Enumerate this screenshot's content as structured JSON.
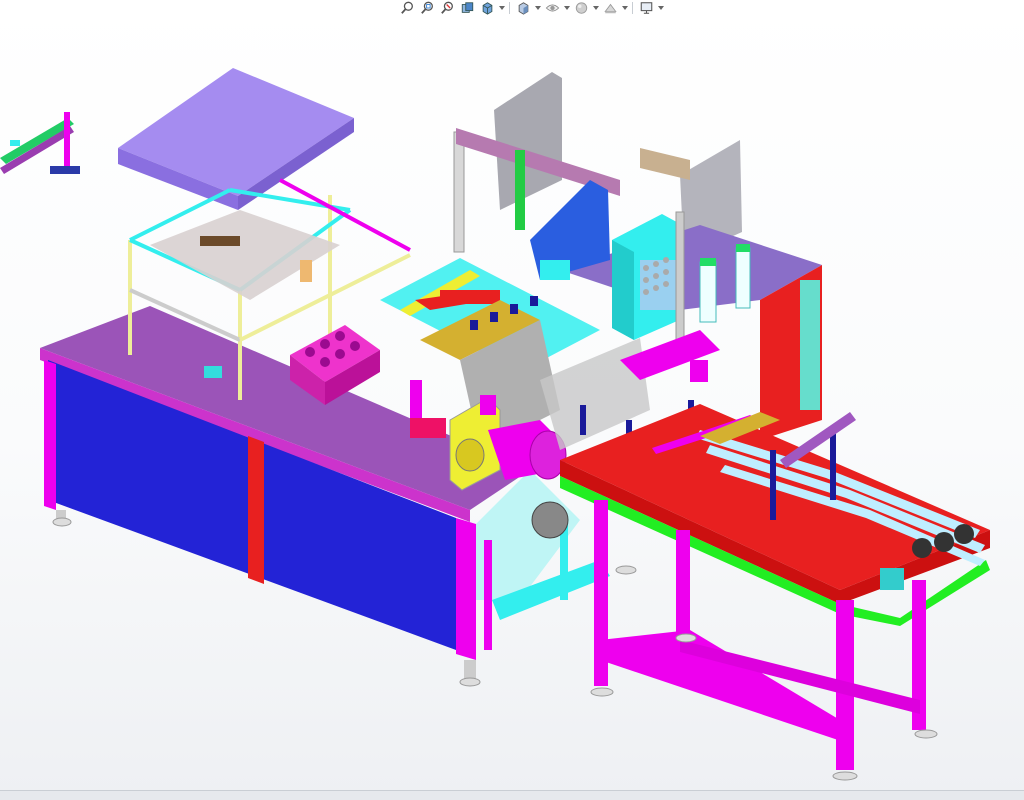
{
  "toolbar": {
    "items": [
      {
        "icon": "zoom-to-fit-icon"
      },
      {
        "icon": "zoom-to-area-icon"
      },
      {
        "icon": "previous-view-icon"
      },
      {
        "icon": "section-view-icon"
      },
      {
        "icon": "view-orientation-icon",
        "dropdown": true
      },
      {
        "icon": "display-style-icon",
        "dropdown": true
      },
      {
        "icon": "hide-show-items-icon",
        "dropdown": true
      },
      {
        "icon": "edit-appearance-icon",
        "dropdown": true
      },
      {
        "icon": "apply-scene-icon",
        "dropdown": true
      },
      {
        "icon": "view-settings-icon",
        "dropdown": true
      }
    ]
  },
  "model": {
    "description_hidden": "",
    "colors": {
      "magenta": "#ee00ee",
      "blue_panel": "#2323d6",
      "purple_top": "#9b54b8",
      "red": "#e82020",
      "green": "#22dd22",
      "cyan": "#33eeee",
      "yellow": "#eeee33",
      "lavender": "#a58cf0",
      "gray": "#a8a8b0"
    }
  }
}
